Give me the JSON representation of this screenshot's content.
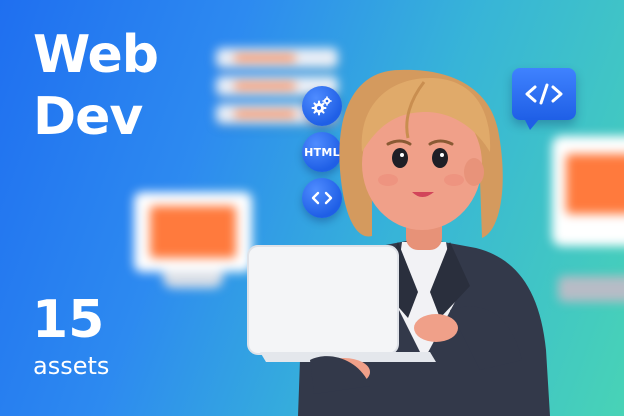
{
  "title": {
    "line1": "Web",
    "line2": "Dev"
  },
  "assets": {
    "count": "15",
    "label": "assets"
  },
  "icons": {
    "settings": "gears-icon",
    "html": "html-icon",
    "code": "code-brackets-icon",
    "bubble": "code-bubble-icon"
  },
  "badge": {
    "html_text": "HTML"
  },
  "colors": {
    "bg_start": "#1f6ff0",
    "bg_end": "#48d3b6",
    "accent_blue": "#1f5fe6",
    "accent_orange": "#ff7a3d",
    "text": "#ffffff"
  }
}
